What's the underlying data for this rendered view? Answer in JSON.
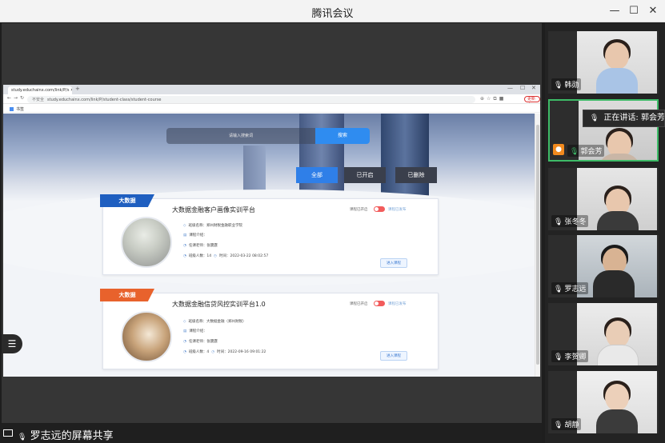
{
  "window": {
    "title": "腾讯会议",
    "minimize": "—",
    "maximize": "☐",
    "close": "✕"
  },
  "share": {
    "label": "罗志远的屏幕共享"
  },
  "browser": {
    "tab_title": "study.educhainx.com/link/P/s",
    "url": "study.educhainx.com/link/P/student-class/student-course",
    "insecure": "不安全",
    "bookmark": "书签",
    "update": "更新 ⋮"
  },
  "page": {
    "search_placeholder": "请输入搜索词",
    "search_button": "搜索",
    "filters": [
      "全部",
      "已开启",
      "已删除"
    ],
    "courses": [
      {
        "tag": "大数据",
        "title": "大数据金融客户画像实训平台",
        "status_left": "课程已开启",
        "status_right": "课程已发布",
        "school": "班级名称：郑州财税金融职业学院",
        "intro": "课程介绍：",
        "teacher": "任课老师：张震霆",
        "students": "班级人数：14",
        "time": "时间：2022-03-22 08:02:57",
        "enter": "进入课程"
      },
      {
        "tag": "大数据",
        "title": "大数据金融信贷风控实训平台1.0",
        "status_left": "课程已开启",
        "status_right": "课程已发布",
        "school": "班级名称：大数据金融（郑州财税）",
        "intro": "课程介绍：",
        "teacher": "任课老师：张震霆",
        "students": "班级人数：4",
        "time": "时间：2022-09-16 09:01:22",
        "enter": "进入课程"
      }
    ]
  },
  "participants": [
    {
      "name": "韩勋"
    },
    {
      "name": "郭会芳"
    },
    {
      "name": "张冬冬"
    },
    {
      "name": "罗志远"
    },
    {
      "name": "李贺卿"
    },
    {
      "name": "胡静"
    }
  ],
  "speaking": "正在讲话: 郭会芳",
  "colors": {
    "accent_blue": "#2f7fe8",
    "active_border": "#3dbb67",
    "ribbon_orange": "#e8622c"
  }
}
